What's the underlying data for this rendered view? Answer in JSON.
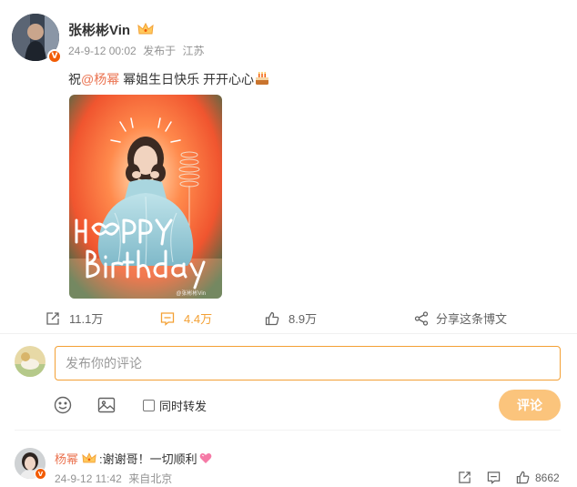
{
  "post": {
    "author": "张彬彬Vin",
    "badge_letter": "V",
    "date": "24-9-12 00:02",
    "source_prefix": "发布于",
    "location": "江苏",
    "text_before": "祝",
    "mention": "@杨幂",
    "text_after": " 幂姐生日快乐 开开心心",
    "image": {
      "overlay_word_1": "HAPPY",
      "overlay_word_2": "Birthday",
      "watermark": "@张彬彬Vin"
    }
  },
  "actions": {
    "repost_count": "11.1万",
    "comment_count": "4.4万",
    "like_count": "8.9万",
    "share_label": "分享这条博文"
  },
  "composer": {
    "placeholder": "发布你的评论",
    "repost_label": "同时转发",
    "submit_label": "评论"
  },
  "comment": {
    "author": "杨幂",
    "badge_letter": "V",
    "text": ":谢谢哥！一切顺利",
    "date": "24-9-12 11:42",
    "source": "来自北京",
    "like_count": "8662"
  },
  "colors": {
    "accent": "#f3a034",
    "mention": "#eb7350",
    "submit_disabled": "#fbc47c",
    "verified_badge": "#f25c05"
  },
  "icons": [
    "crown-icon",
    "cake-emoji-icon",
    "repost-icon",
    "comment-icon",
    "like-icon",
    "share-icon",
    "emoji-icon",
    "image-icon",
    "heart-emoji-icon"
  ]
}
